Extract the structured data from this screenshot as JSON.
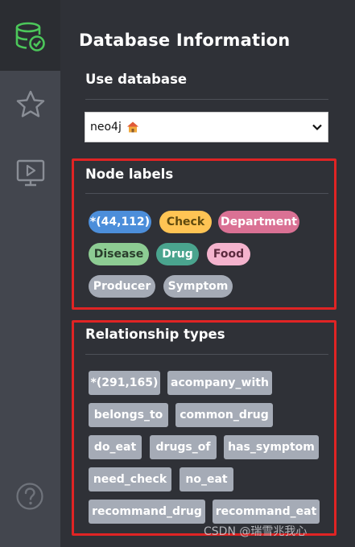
{
  "panel": {
    "title": "Database Information",
    "use_database_heading": "Use database",
    "node_labels_heading": "Node labels",
    "relationship_types_heading": "Relationship types"
  },
  "database_select": {
    "selected_value": "neo4j",
    "icon": "house-icon"
  },
  "node_labels": [
    {
      "label": "*(44,112)",
      "color": "#4c8eda",
      "text_color": "#ffffff"
    },
    {
      "label": "Check",
      "color": "#ffc454",
      "text_color": "#604a0e"
    },
    {
      "label": "Department",
      "color": "#da7194",
      "text_color": "#ffffff"
    },
    {
      "label": "Disease",
      "color": "#8dcc93",
      "text_color": "#2a3e2c"
    },
    {
      "label": "Drug",
      "color": "#4aa48e",
      "text_color": "#ffffff"
    },
    {
      "label": "Food",
      "color": "#f4b3cd",
      "text_color": "#5c2a3e"
    },
    {
      "label": "Producer",
      "color": "#a5abb6",
      "text_color": "#ffffff"
    },
    {
      "label": "Symptom",
      "color": "#a5abb6",
      "text_color": "#ffffff"
    }
  ],
  "relationship_types": [
    "*(291,165)",
    "acompany_with",
    "belongs_to",
    "common_drug",
    "do_eat",
    "drugs_of",
    "has_symptom",
    "need_check",
    "no_eat",
    "recommand_drug",
    "recommand_eat"
  ],
  "sidebar": {
    "icons": [
      "database-check-icon",
      "star-icon",
      "monitor-play-icon",
      "help-icon"
    ],
    "active_color": "#4cc75a"
  },
  "watermark": "CSDN @瑞雪兆我心"
}
